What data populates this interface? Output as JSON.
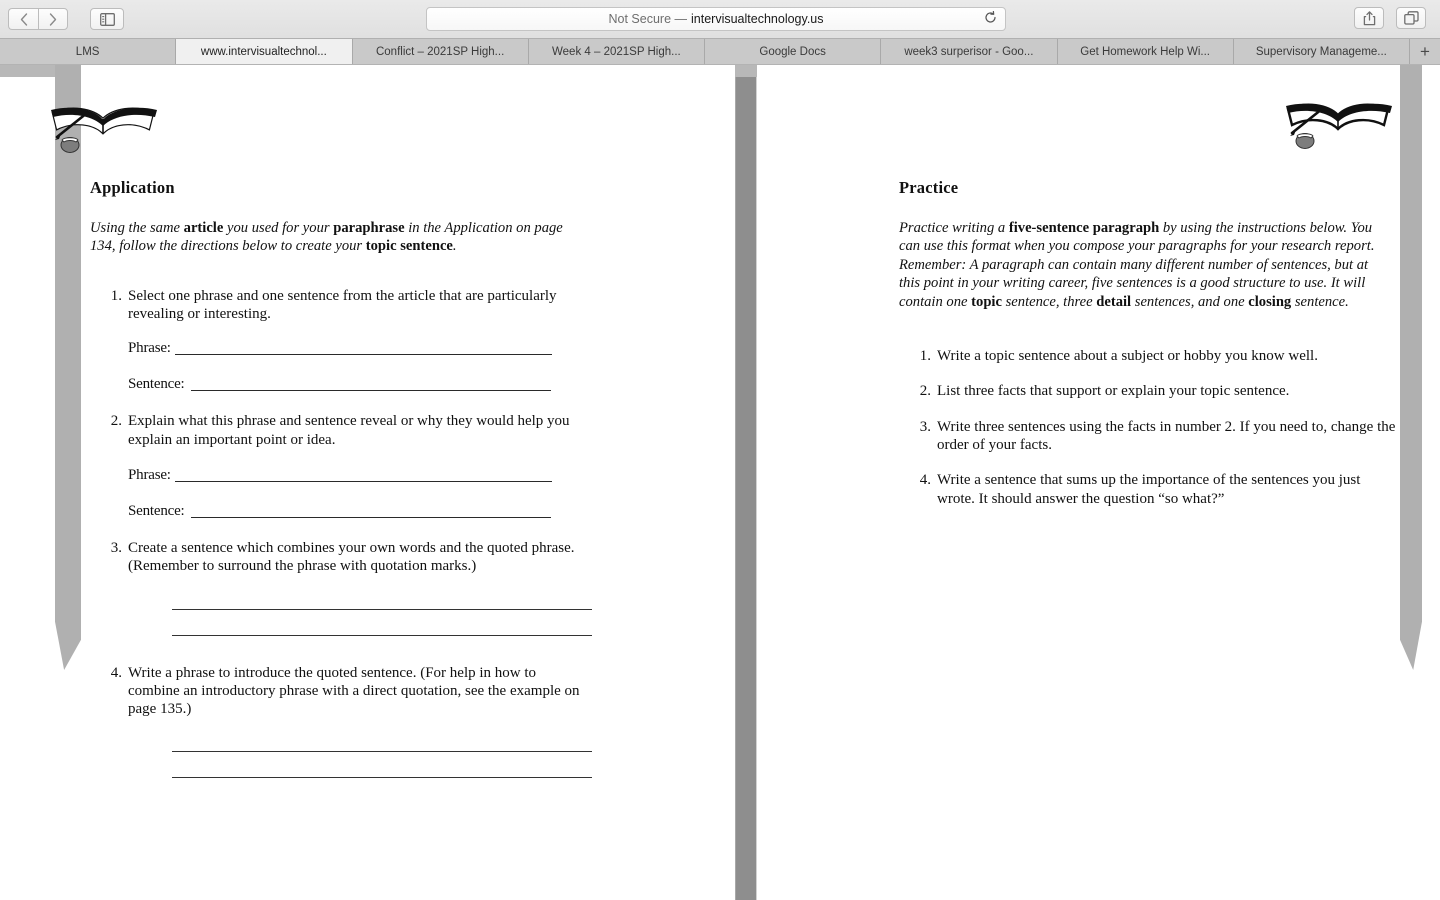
{
  "browser": {
    "back_label": "‹",
    "forward_label": "›",
    "url_security_label": "Not Secure —",
    "url_host": "intervisualtechnology.us",
    "tabs": [
      {
        "label": "LMS",
        "active": false
      },
      {
        "label": "www.intervisualtechnol...",
        "active": true
      },
      {
        "label": "Conflict – 2021SP High...",
        "active": false
      },
      {
        "label": "Week 4 – 2021SP High...",
        "active": false
      },
      {
        "label": "Google Docs",
        "active": false
      },
      {
        "label": "week3 surperisor - Goo...",
        "active": false
      },
      {
        "label": "Get Homework Help Wi...",
        "active": false
      },
      {
        "label": "Supervisory Manageme...",
        "active": false
      }
    ],
    "new_tab_label": "+"
  },
  "left_page": {
    "heading": "Application",
    "intro": {
      "part1": "Using the same ",
      "bold1": "article",
      "part2": " you used for your ",
      "bold2": "paraphrase",
      "part3": " in the Application on page 134, follow the directions below to create your ",
      "bold3": "topic sentence",
      "part4": "."
    },
    "items": [
      {
        "num": "1.",
        "text": "Select one phrase and one sentence from the article that are particularly revealing or interesting.",
        "fields": [
          {
            "label": "Phrase:"
          },
          {
            "label": "Sentence:"
          }
        ]
      },
      {
        "num": "2.",
        "text": "Explain what this phrase and sentence reveal or why they would help you explain an important point or idea.",
        "fields": [
          {
            "label": "Phrase:"
          },
          {
            "label": "Sentence:"
          }
        ]
      },
      {
        "num": "3.",
        "text": "Create a sentence which combines your own words and the quoted phrase. (Remember to surround the phrase with quotation marks.)",
        "fields": []
      },
      {
        "num": "4.",
        "text": "Write a phrase to introduce the quoted sentence. (For help in how to combine an introductory phrase with a direct quotation, see the example on page 135.)",
        "fields": []
      }
    ]
  },
  "right_page": {
    "heading": "Practice",
    "intro": {
      "part1": "Practice writing a ",
      "bold1": "five-sentence paragraph",
      "part2": " by using the instructions below. You can use this format when you compose your paragraphs for your research report. Remember: A paragraph can contain many different number of sentences, but at this point in your writing career, five sentences is a good structure to use. It will contain one ",
      "bold2": "topic",
      "part3": " sentence, three ",
      "bold3": "detail",
      "part4": " sentences, and one ",
      "bold4": "closing",
      "part5": " sentence."
    },
    "items": [
      {
        "num": "1.",
        "text": "Write a topic sentence about a subject or hobby you know well."
      },
      {
        "num": "2.",
        "text": "List three facts that support or explain your topic sentence."
      },
      {
        "num": "3.",
        "text": "Write three sentences using the facts in number 2. If you need to, change the order of your facts."
      },
      {
        "num": "4.",
        "text": "Write a sentence that sums up the importance of the sentences you just wrote. It should answer the question “so what?”"
      }
    ]
  },
  "colors": {
    "page_background": "#ffffff",
    "gutter_gray": "#8e8e8e",
    "curl_gray": "#b0b0b0",
    "chrome_gray": "#d9d9d9",
    "tab_inactive": "#c9c9c9",
    "tab_active": "#f0f0f0",
    "rule_color": "#2a2a2a"
  }
}
